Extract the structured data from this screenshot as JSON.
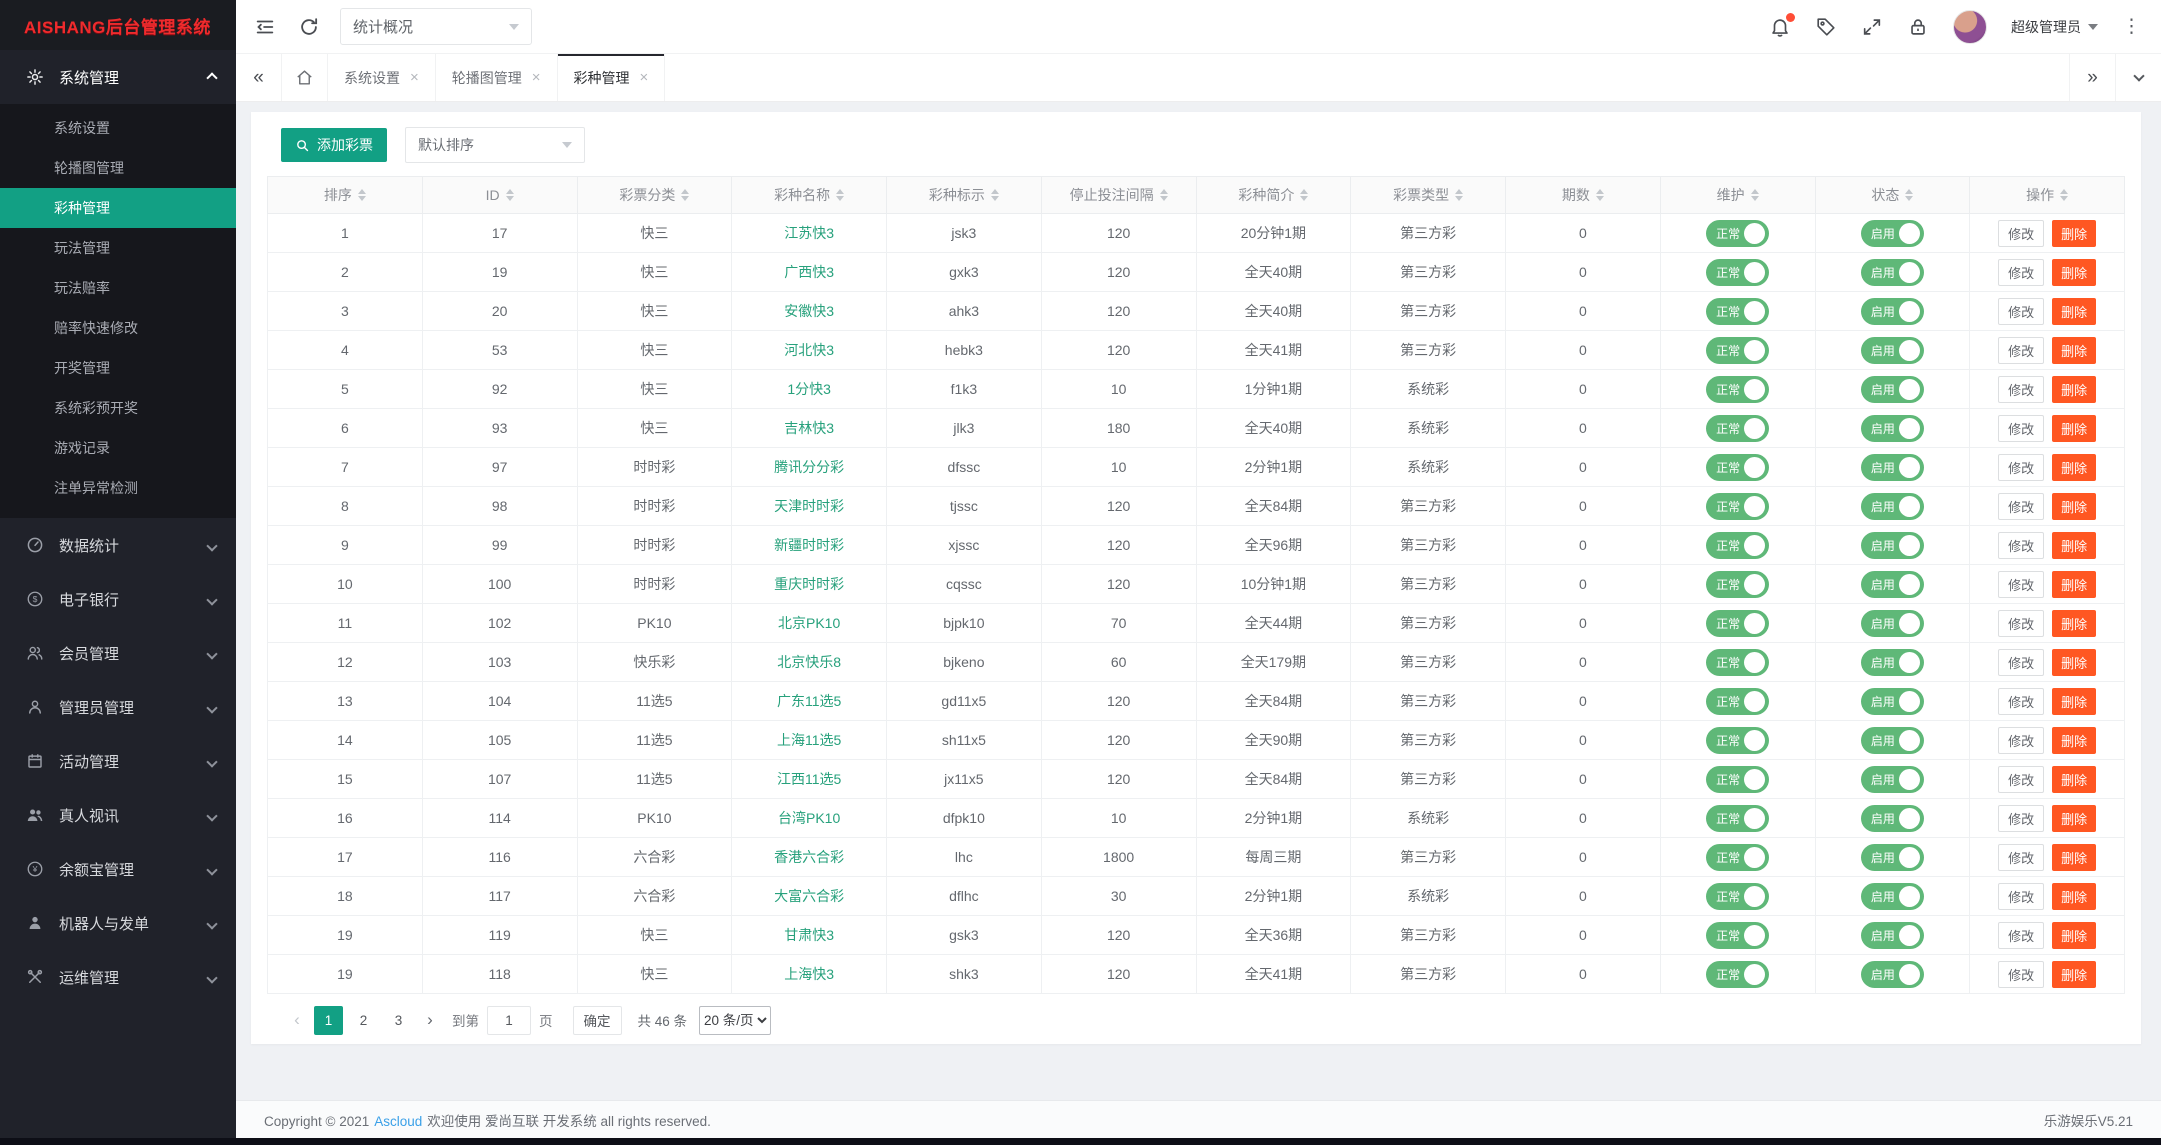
{
  "app": {
    "logo": "AISHANG后台管理系统",
    "version": "乐游娱乐V5.21"
  },
  "colors": {
    "accent": "#12a084",
    "toggle_green": "#5fb878",
    "danger": "#ff5722",
    "link_green": "#27a17c",
    "footer_link_blue": "#3aa0e8"
  },
  "topbar": {
    "nav_select_value": "统计概况",
    "username": "超级管理员",
    "icons": [
      "collapse-menu-icon",
      "refresh-icon",
      "notifications-icon",
      "tag-icon",
      "fullscreen-icon",
      "lock-icon",
      "more-icon"
    ]
  },
  "tabs": {
    "items": [
      {
        "label": "系统设置"
      },
      {
        "label": "轮播图管理"
      },
      {
        "label": "彩种管理",
        "active": true
      }
    ]
  },
  "sidebar": {
    "sections": [
      {
        "label": "系统管理",
        "icon": "gear-icon",
        "expanded": true,
        "items": [
          {
            "label": "系统设置"
          },
          {
            "label": "轮播图管理"
          },
          {
            "label": "彩种管理",
            "active": true
          },
          {
            "label": "玩法管理"
          },
          {
            "label": "玩法赔率"
          },
          {
            "label": "赔率快速修改"
          },
          {
            "label": "开奖管理"
          },
          {
            "label": "系统彩预开奖"
          },
          {
            "label": "游戏记录"
          },
          {
            "label": "注单异常检测"
          }
        ]
      },
      {
        "label": "数据统计",
        "icon": "gauge-icon"
      },
      {
        "label": "电子银行",
        "icon": "dollar-icon"
      },
      {
        "label": "会员管理",
        "icon": "users-icon"
      },
      {
        "label": "管理员管理",
        "icon": "admin-icon"
      },
      {
        "label": "活动管理",
        "icon": "calendar-icon"
      },
      {
        "label": "真人视讯",
        "icon": "video-users-icon"
      },
      {
        "label": "余额宝管理",
        "icon": "yuan-icon"
      },
      {
        "label": "机器人与发单",
        "icon": "robot-icon"
      },
      {
        "label": "运维管理",
        "icon": "tools-icon"
      }
    ]
  },
  "toolbar": {
    "add_button": "添加彩票",
    "sort_select": "默认排序"
  },
  "table": {
    "headers": [
      "排序",
      "ID",
      "彩票分类",
      "彩种名称",
      "彩种标示",
      "停止投注间隔",
      "彩种简介",
      "彩票类型",
      "期数",
      "维护",
      "状态",
      "操作"
    ],
    "maintain_on": "正常",
    "status_on": "启用",
    "edit": "修改",
    "delete": "删除",
    "rows": [
      {
        "sort": "1",
        "id": "17",
        "category": "快三",
        "name": "江苏快3",
        "code": "jsk3",
        "interval": "120",
        "intro": "20分钟1期",
        "type": "第三方彩",
        "periods": "0"
      },
      {
        "sort": "2",
        "id": "19",
        "category": "快三",
        "name": "广西快3",
        "code": "gxk3",
        "interval": "120",
        "intro": "全天40期",
        "type": "第三方彩",
        "periods": "0"
      },
      {
        "sort": "3",
        "id": "20",
        "category": "快三",
        "name": "安徽快3",
        "code": "ahk3",
        "interval": "120",
        "intro": "全天40期",
        "type": "第三方彩",
        "periods": "0"
      },
      {
        "sort": "4",
        "id": "53",
        "category": "快三",
        "name": "河北快3",
        "code": "hebk3",
        "interval": "120",
        "intro": "全天41期",
        "type": "第三方彩",
        "periods": "0"
      },
      {
        "sort": "5",
        "id": "92",
        "category": "快三",
        "name": "1分快3",
        "code": "f1k3",
        "interval": "10",
        "intro": "1分钟1期",
        "type": "系统彩",
        "periods": "0"
      },
      {
        "sort": "6",
        "id": "93",
        "category": "快三",
        "name": "吉林快3",
        "code": "jlk3",
        "interval": "180",
        "intro": "全天40期",
        "type": "系统彩",
        "periods": "0"
      },
      {
        "sort": "7",
        "id": "97",
        "category": "时时彩",
        "name": "腾讯分分彩",
        "code": "dfssc",
        "interval": "10",
        "intro": "2分钟1期",
        "type": "系统彩",
        "periods": "0"
      },
      {
        "sort": "8",
        "id": "98",
        "category": "时时彩",
        "name": "天津时时彩",
        "code": "tjssc",
        "interval": "120",
        "intro": "全天84期",
        "type": "第三方彩",
        "periods": "0"
      },
      {
        "sort": "9",
        "id": "99",
        "category": "时时彩",
        "name": "新疆时时彩",
        "code": "xjssc",
        "interval": "120",
        "intro": "全天96期",
        "type": "第三方彩",
        "periods": "0"
      },
      {
        "sort": "10",
        "id": "100",
        "category": "时时彩",
        "name": "重庆时时彩",
        "code": "cqssc",
        "interval": "120",
        "intro": "10分钟1期",
        "type": "第三方彩",
        "periods": "0"
      },
      {
        "sort": "11",
        "id": "102",
        "category": "PK10",
        "name": "北京PK10",
        "code": "bjpk10",
        "interval": "70",
        "intro": "全天44期",
        "type": "第三方彩",
        "periods": "0"
      },
      {
        "sort": "12",
        "id": "103",
        "category": "快乐彩",
        "name": "北京快乐8",
        "code": "bjkeno",
        "interval": "60",
        "intro": "全天179期",
        "type": "第三方彩",
        "periods": "0"
      },
      {
        "sort": "13",
        "id": "104",
        "category": "11选5",
        "name": "广东11选5",
        "code": "gd11x5",
        "interval": "120",
        "intro": "全天84期",
        "type": "第三方彩",
        "periods": "0"
      },
      {
        "sort": "14",
        "id": "105",
        "category": "11选5",
        "name": "上海11选5",
        "code": "sh11x5",
        "interval": "120",
        "intro": "全天90期",
        "type": "第三方彩",
        "periods": "0"
      },
      {
        "sort": "15",
        "id": "107",
        "category": "11选5",
        "name": "江西11选5",
        "code": "jx11x5",
        "interval": "120",
        "intro": "全天84期",
        "type": "第三方彩",
        "periods": "0"
      },
      {
        "sort": "16",
        "id": "114",
        "category": "PK10",
        "name": "台湾PK10",
        "code": "dfpk10",
        "interval": "10",
        "intro": "2分钟1期",
        "type": "系统彩",
        "periods": "0"
      },
      {
        "sort": "17",
        "id": "116",
        "category": "六合彩",
        "name": "香港六合彩",
        "code": "lhc",
        "interval": "1800",
        "intro": "每周三期",
        "type": "第三方彩",
        "periods": "0"
      },
      {
        "sort": "18",
        "id": "117",
        "category": "六合彩",
        "name": "大富六合彩",
        "code": "dflhc",
        "interval": "30",
        "intro": "2分钟1期",
        "type": "系统彩",
        "periods": "0"
      },
      {
        "sort": "19",
        "id": "119",
        "category": "快三",
        "name": "甘肃快3",
        "code": "gsk3",
        "interval": "120",
        "intro": "全天36期",
        "type": "第三方彩",
        "periods": "0"
      },
      {
        "sort": "19",
        "id": "118",
        "category": "快三",
        "name": "上海快3",
        "code": "shk3",
        "interval": "120",
        "intro": "全天41期",
        "type": "第三方彩",
        "periods": "0"
      }
    ]
  },
  "pagination": {
    "prev": "‹",
    "next": "›",
    "pages": [
      "1",
      "2",
      "3"
    ],
    "current": "1",
    "goto_prefix": "到第",
    "goto_value": "1",
    "goto_suffix": "页",
    "confirm": "确定",
    "total": "共 46 条",
    "page_size": "20 条/页"
  },
  "footer": {
    "copyright_prefix": "Copyright © 2021",
    "copyright_link": "Ascloud",
    "copyright_suffix": "欢迎使用 爱尚互联 开发系统 all rights reserved."
  }
}
